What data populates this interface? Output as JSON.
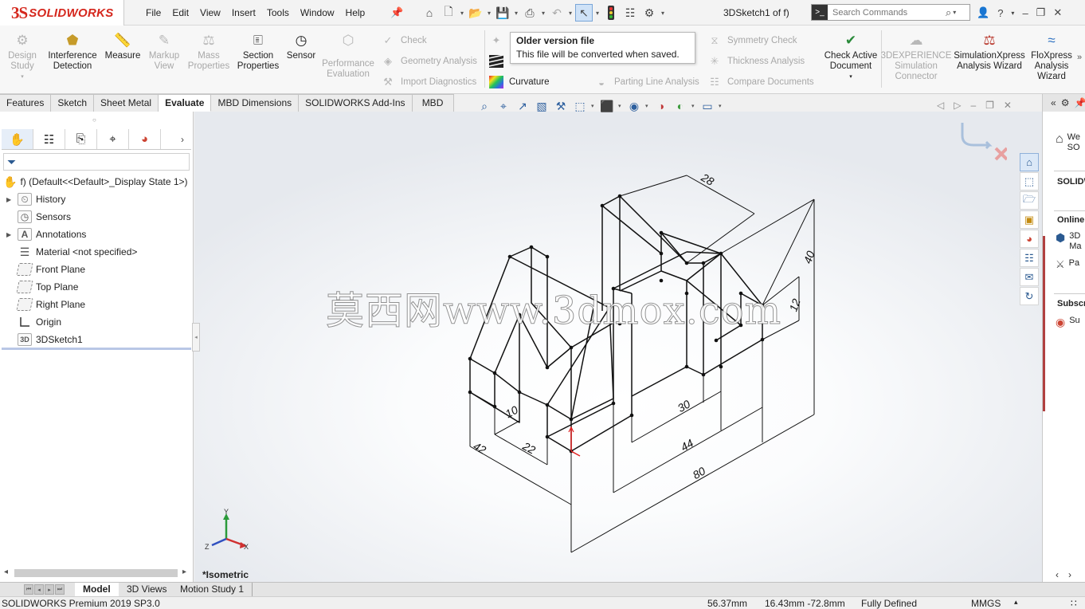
{
  "app": {
    "logo_mark": "3S",
    "logo_name": "SOLIDWORKS",
    "doc_title": "3DSketch1 of f)"
  },
  "menu": [
    "File",
    "Edit",
    "View",
    "Insert",
    "Tools",
    "Window",
    "Help"
  ],
  "search": {
    "placeholder": "Search Commands"
  },
  "commands": {
    "design_study": "Design\nStudy",
    "interference": "Interference\nDetection",
    "measure": "Measure",
    "markup_view": "Markup\nView",
    "mass_properties": "Mass\nProperties",
    "section_properties": "Section\nProperties",
    "sensor": "Sensor",
    "performance_evaluation": "Performance\nEvaluation",
    "check": "Check",
    "geometry_analysis": "Geometry Analysis",
    "import_diagnostics": "Import Diagnostics",
    "curvature": "Curvature",
    "parting_line": "Parting Line Analysis",
    "symmetry_check": "Symmetry Check",
    "thickness_analysis": "Thickness Analysis",
    "compare_documents": "Compare Documents",
    "check_active": "Check Active\nDocument",
    "experience_sim": "3DEXPERIENCE\nSimulation\nConnector",
    "simxpress": "SimulationXpress\nAnalysis Wizard",
    "floxpress": "FloXpress\nAnalysis\nWizard"
  },
  "tooltip": {
    "title": "Older version file",
    "body": "This file will be converted when saved."
  },
  "tabs": [
    "Features",
    "Sketch",
    "Sheet Metal",
    "Evaluate",
    "MBD Dimensions",
    "SOLIDWORKS Add-Ins",
    "MBD"
  ],
  "active_tab": "Evaluate",
  "tree": {
    "root": "f)  (Default<<Default>_Display State 1>)",
    "items": [
      {
        "label": "History",
        "icon": "history-folder-icon",
        "expandable": true
      },
      {
        "label": "Sensors",
        "icon": "sensors-folder-icon",
        "expandable": false
      },
      {
        "label": "Annotations",
        "icon": "annotations-icon",
        "expandable": true
      },
      {
        "label": "Material <not specified>",
        "icon": "material-icon",
        "expandable": false
      },
      {
        "label": "Front Plane",
        "icon": "plane-icon",
        "expandable": false
      },
      {
        "label": "Top Plane",
        "icon": "plane-icon",
        "expandable": false
      },
      {
        "label": "Right Plane",
        "icon": "plane-icon",
        "expandable": false
      },
      {
        "label": "Origin",
        "icon": "origin-icon",
        "expandable": false
      },
      {
        "label": "3DSketch1",
        "icon": "3dsketch-icon",
        "expandable": false
      }
    ]
  },
  "viewport": {
    "view_name": "*Isometric",
    "watermark": "莫西网www.3dmox.com",
    "dimensions": [
      "28",
      "40",
      "12",
      "10",
      "42",
      "22",
      "30",
      "44",
      "80"
    ],
    "triad": {
      "x": "X",
      "y": "Y",
      "z": "Z"
    }
  },
  "taskpane": {
    "welcome": "We\nSO",
    "solidworks": "SOLIDW",
    "online": "Online",
    "item1": "3D\nMa",
    "item2": "Pa",
    "subscription": "Subscri",
    "item3": "Su"
  },
  "bottom_tabs": [
    "Model",
    "3D Views",
    "Motion Study 1"
  ],
  "active_bottom_tab": "Model",
  "status": {
    "product": "SOLIDWORKS Premium 2019 SP3.0",
    "length": "56.37mm",
    "coords": "16.43mm -72.8mm",
    "state": "Fully Defined",
    "units": "MMGS"
  },
  "colors": {
    "brand": "#d5271d",
    "accent": "#2b5a91",
    "sketch_line": "#111111",
    "origin_red": "#e02020"
  }
}
